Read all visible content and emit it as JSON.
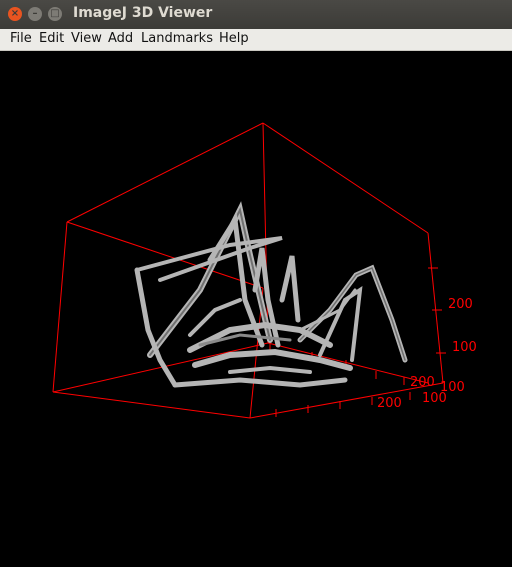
{
  "window": {
    "title": "ImageJ 3D Viewer",
    "controls": {
      "close": "×",
      "minimize": "–",
      "maximize": "□"
    }
  },
  "menubar": {
    "items": [
      "File",
      "Edit",
      "View",
      "Add",
      "Landmarks",
      "Help"
    ]
  },
  "viewer": {
    "background": "#000000",
    "box_color": "#ff0000",
    "surface_color": "#b5b5b5",
    "axis_labels": {
      "z": [
        "200",
        "100"
      ],
      "right": [
        "200",
        "100"
      ],
      "bottom": [
        "200",
        "100"
      ]
    }
  }
}
